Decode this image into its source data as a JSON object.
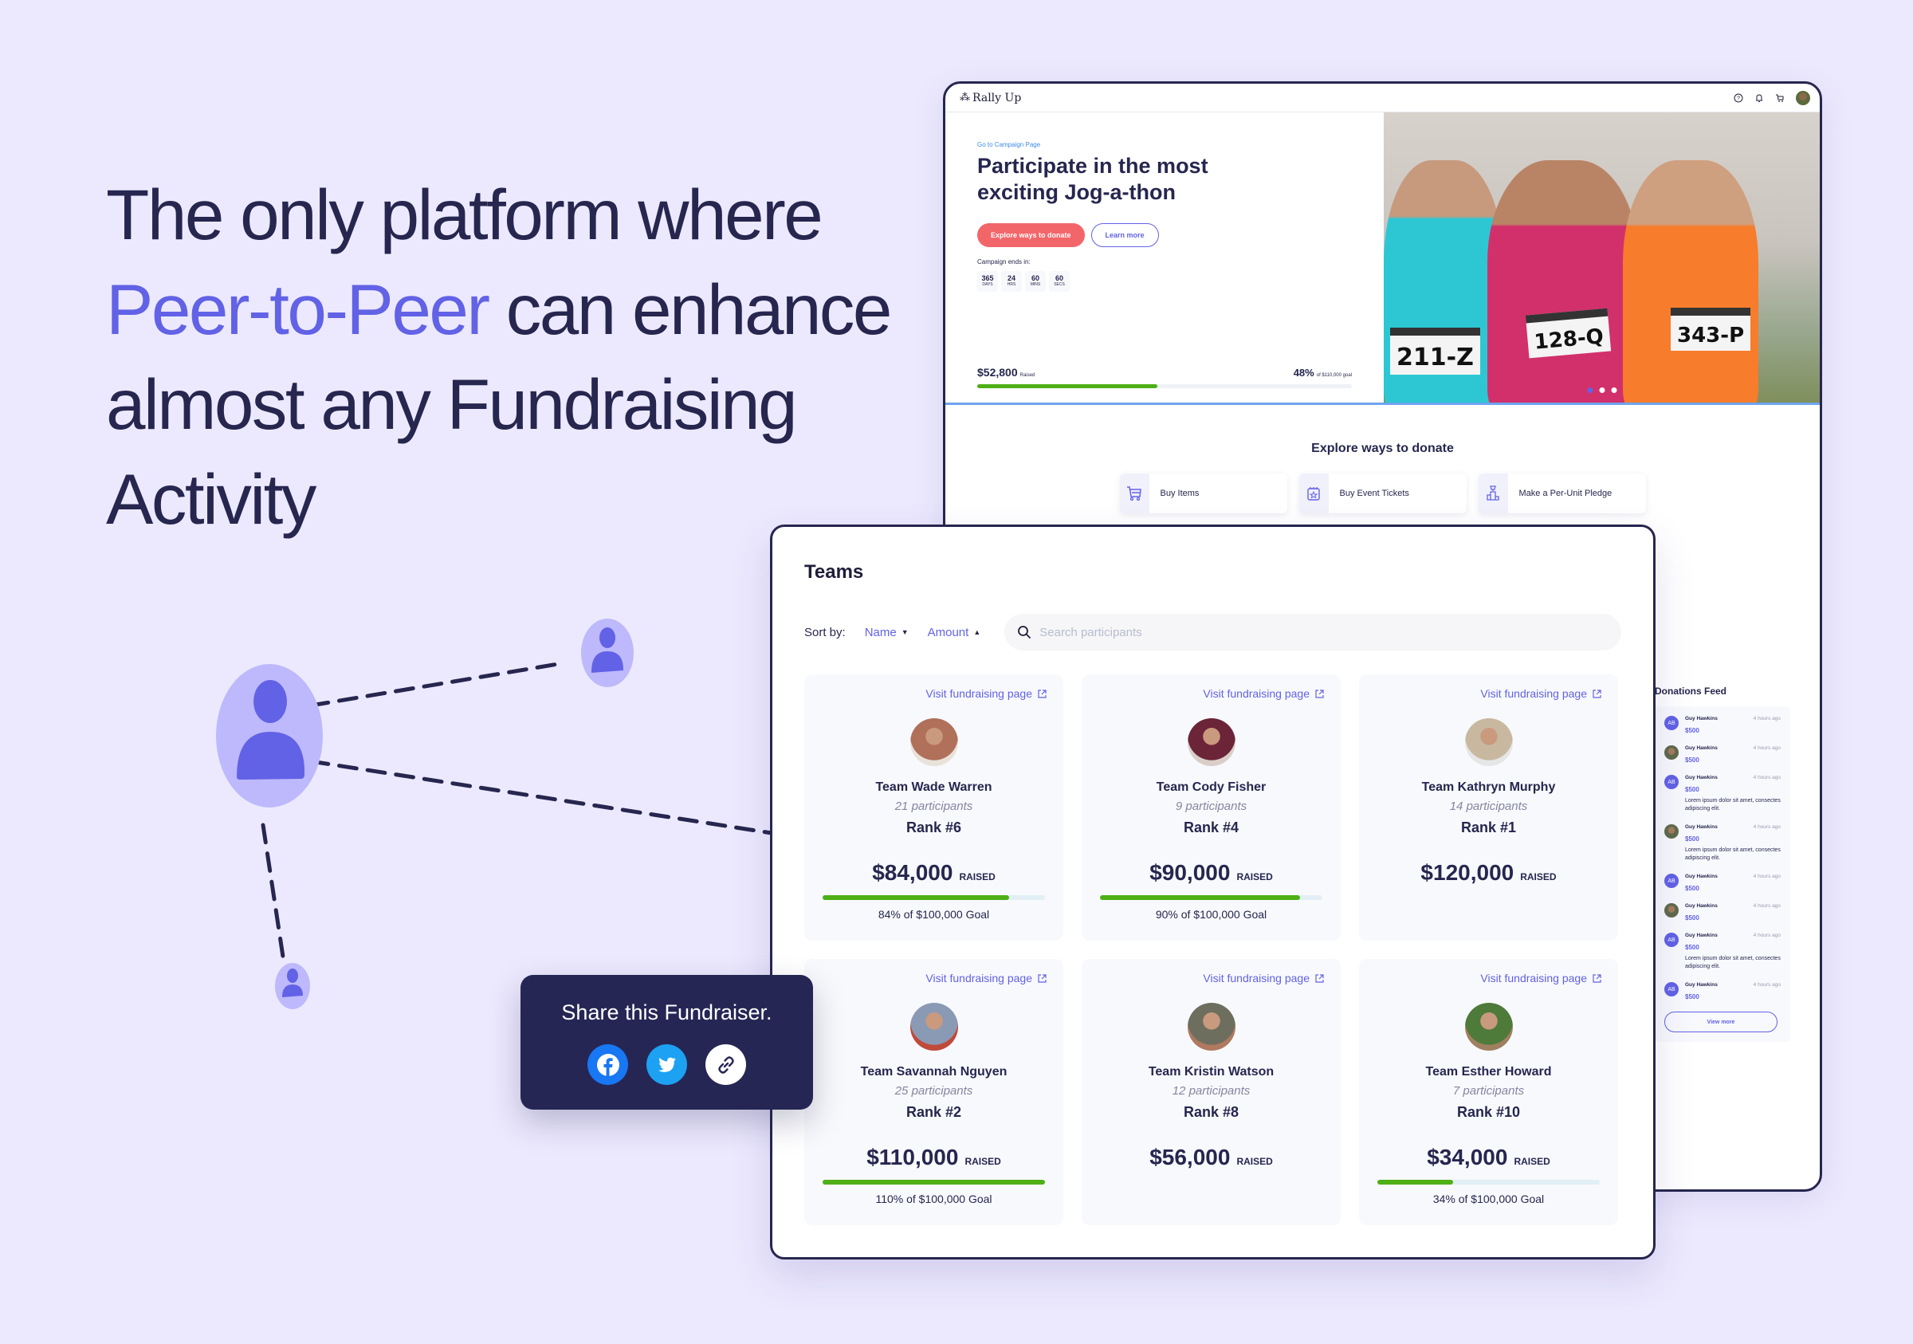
{
  "headline": {
    "before": "The only platform where ",
    "accent": "Peer-to-Peer",
    "after": " can enhance almost any Fundraising Activity"
  },
  "colors": {
    "background": "#ECE9FE",
    "navy": "#26264F",
    "accent": "#6262E6",
    "primary_button": "#F2666A",
    "progress": "#4FAF16",
    "facebook": "#1877F2",
    "twitter": "#1DA1F2"
  },
  "diagram": {
    "nodes": [
      "person-icon-large",
      "person-icon-medium",
      "person-icon-small"
    ]
  },
  "campaign": {
    "brand": "Rally Up",
    "topbar_icons": [
      "help-icon",
      "bell-icon",
      "cart-icon",
      "user-avatar"
    ],
    "back_link": "Go to Campaign Page",
    "title": "Participate in the most exciting Jog-a-thon",
    "primary_button": "Explore ways to donate",
    "secondary_button": "Learn more",
    "ends_label": "Campaign ends in:",
    "countdown": [
      {
        "value": "365",
        "unit": "DAYS"
      },
      {
        "value": "24",
        "unit": "HRS"
      },
      {
        "value": "60",
        "unit": "MINS"
      },
      {
        "value": "60",
        "unit": "SECS"
      }
    ],
    "raised_amount": "$52,800",
    "raised_label": "Raised",
    "percent": "48%",
    "goal_label": "of $110,000 goal",
    "progress_fraction": 0.48,
    "photo_bibs": [
      "211-Z",
      "128-Q",
      "343-P"
    ],
    "carousel": {
      "count": 3,
      "active": 0
    },
    "explore_title": "Explore ways to donate",
    "explore_options": [
      {
        "icon": "cart-icon",
        "label": "Buy Items"
      },
      {
        "icon": "ticket-calendar-icon",
        "label": "Buy Event Tickets"
      },
      {
        "icon": "podium-trophy-icon",
        "label": "Make a Per-Unit Pledge"
      }
    ]
  },
  "feed": {
    "title": "Donations Feed",
    "items": [
      {
        "avatar": "AB",
        "photo": false,
        "name": "Guy Hawkins",
        "time": "4 hours ago",
        "amount": "$500",
        "message": ""
      },
      {
        "avatar": "",
        "photo": true,
        "name": "Guy Hawkins",
        "time": "4 hours ago",
        "amount": "$500",
        "message": ""
      },
      {
        "avatar": "AB",
        "photo": false,
        "name": "Guy Hawkins",
        "time": "4 hours ago",
        "amount": "$500",
        "message": "Lorem ipsum dolor sit amet, consectes adipiscing elit."
      },
      {
        "avatar": "",
        "photo": true,
        "name": "Guy Hawkins",
        "time": "4 hours ago",
        "amount": "$500",
        "message": "Lorem ipsum dolor sit amet, consectes adipiscing elit."
      },
      {
        "avatar": "AB",
        "photo": false,
        "name": "Guy Hawkins",
        "time": "4 hours ago",
        "amount": "$500",
        "message": ""
      },
      {
        "avatar": "",
        "photo": true,
        "name": "Guy Hawkins",
        "time": "4 hours ago",
        "amount": "$500",
        "message": ""
      },
      {
        "avatar": "AB",
        "photo": false,
        "name": "Guy Hawkins",
        "time": "4 hours ago",
        "amount": "$500",
        "message": "Lorem ipsum dolor sit amet, consectes adipiscing elit."
      },
      {
        "avatar": "AB",
        "photo": false,
        "name": "Guy Hawkins",
        "time": "4 hours ago",
        "amount": "$500",
        "message": ""
      }
    ],
    "view_more": "View more"
  },
  "teams": {
    "title": "Teams",
    "sort_label": "Sort by:",
    "sort_options": [
      {
        "label": "Name",
        "direction": "down"
      },
      {
        "label": "Amount",
        "direction": "up"
      }
    ],
    "search_placeholder": "Search participants",
    "search_value": "",
    "visit_label": "Visit fundraising page",
    "raised_label": "RAISED",
    "cards": [
      {
        "name": "Team Wade Warren",
        "participants": "21 participants",
        "rank": "Rank #6",
        "amount": "$84,000",
        "goal_text": "84% of $100,000 Goal",
        "progress": 0.84,
        "show_bar": true,
        "avatar_colors": [
          "#B0705A",
          "#E8E2DA"
        ]
      },
      {
        "name": "Team Cody Fisher",
        "participants": "9 participants",
        "rank": "Rank #4",
        "amount": "$90,000",
        "goal_text": "90% of $100,000 Goal",
        "progress": 0.9,
        "show_bar": true,
        "avatar_colors": [
          "#6B2438",
          "#D9CFC8"
        ]
      },
      {
        "name": "Team Kathryn Murphy",
        "participants": "14 participants",
        "rank": "Rank #1",
        "amount": "$120,000",
        "goal_text": "",
        "progress": 1.0,
        "show_bar": false,
        "avatar_colors": [
          "#C8B8A0",
          "#E6E6E6"
        ]
      },
      {
        "name": "Team Savannah Nguyen",
        "participants": "25 participants",
        "rank": "Rank #2",
        "amount": "$110,000",
        "goal_text": "110% of $100,000 Goal",
        "progress": 1.1,
        "show_bar": true,
        "avatar_colors": [
          "#8A9AB4",
          "#C04A3A"
        ]
      },
      {
        "name": "Team Kristin Watson",
        "participants": "12 participants",
        "rank": "Rank #8",
        "amount": "$56,000",
        "goal_text": "",
        "progress": 0.56,
        "show_bar": false,
        "avatar_colors": [
          "#6E6E5E",
          "#B07A60"
        ]
      },
      {
        "name": "Team Esther Howard",
        "participants": "7 participants",
        "rank": "Rank #10",
        "amount": "$34,000",
        "goal_text": "34% of $100,000 Goal",
        "progress": 0.34,
        "show_bar": true,
        "avatar_colors": [
          "#4E7A3A",
          "#A08060"
        ]
      }
    ]
  },
  "share": {
    "title": "Share this Fundraiser.",
    "buttons": [
      {
        "icon": "facebook-icon",
        "label": "Facebook"
      },
      {
        "icon": "twitter-icon",
        "label": "Twitter"
      },
      {
        "icon": "link-icon",
        "label": "Copy link"
      }
    ]
  }
}
